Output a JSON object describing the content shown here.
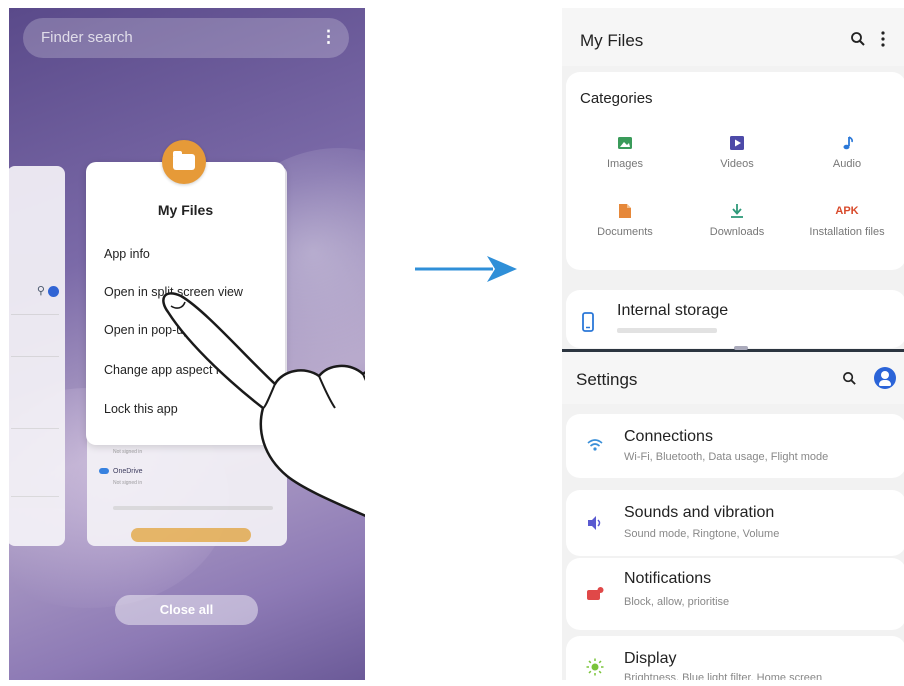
{
  "recents": {
    "search": {
      "placeholder": "Finder search",
      "menu_icon": "⋮"
    },
    "popup": {
      "app_name": "My Files",
      "items": [
        "App info",
        "Open in split screen view",
        "Open in pop-up view",
        "Change app aspect ratio",
        "Lock this app"
      ]
    },
    "background_card": {
      "onedrive_label": "OneDrive",
      "onedrive_sub": "Not signed in",
      "not_signed": "Not signed in"
    },
    "close_all_label": "Close all"
  },
  "myfiles": {
    "title": "My Files",
    "categories_label": "Categories",
    "categories": [
      {
        "label": "Images",
        "icon": "image-icon",
        "color": "#3a9b5a"
      },
      {
        "label": "Videos",
        "icon": "video-icon",
        "color": "#4d4aa8"
      },
      {
        "label": "Audio",
        "icon": "music-note-icon",
        "color": "#2b78d8"
      },
      {
        "label": "Documents",
        "icon": "document-icon",
        "color": "#e6883a"
      },
      {
        "label": "Downloads",
        "icon": "download-icon",
        "color": "#2f9a7a"
      },
      {
        "label": "Installation files",
        "icon": "apk-icon",
        "color": "#d84a2b",
        "glyph": "APK"
      }
    ],
    "internal_storage": {
      "label": "Internal storage",
      "detail": ""
    }
  },
  "settings": {
    "title": "Settings",
    "items": [
      {
        "title": "Connections",
        "sub": "Wi-Fi, Bluetooth, Data usage, Flight mode",
        "icon": "wifi-icon",
        "color": "#3a8fd8"
      },
      {
        "title": "Sounds and vibration",
        "sub": "Sound mode, Ringtone, Volume",
        "icon": "speaker-icon",
        "color": "#5a5ad0"
      },
      {
        "title": "Notifications",
        "sub": "Block, allow, prioritise",
        "icon": "notification-icon",
        "color": "#e04848"
      },
      {
        "title": "Display",
        "sub": "Brightness, Blue light filter, Home screen",
        "icon": "brightness-icon",
        "color": "#7ac43a"
      }
    ]
  },
  "colors": {
    "accent_blue": "#2b64d8",
    "arrow_blue": "#2f8fd8",
    "myfiles_orange": "#e69a38"
  }
}
